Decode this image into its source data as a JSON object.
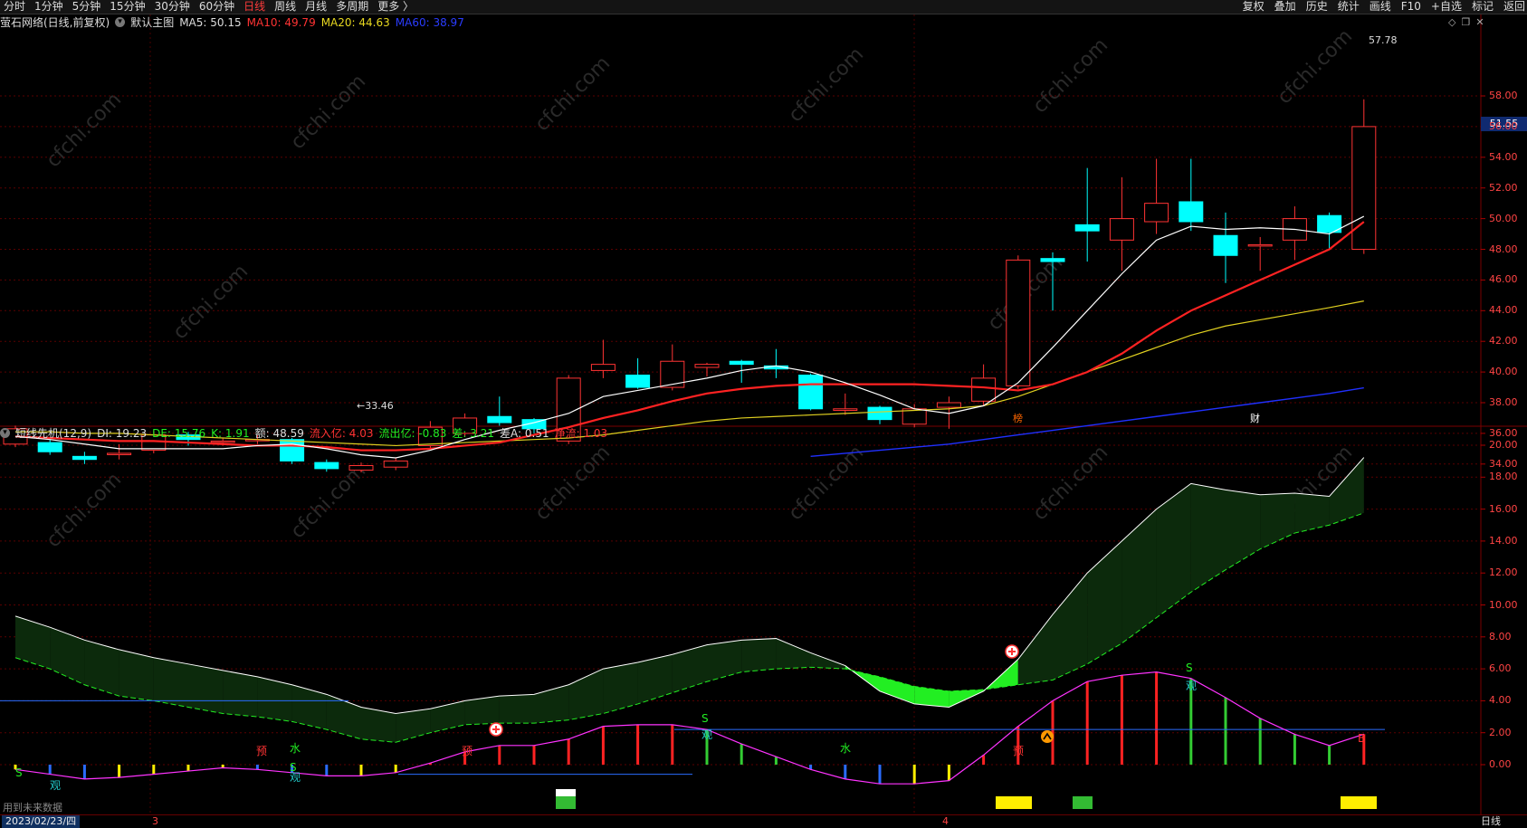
{
  "topbar": {
    "periods": [
      "分时",
      "1分钟",
      "5分钟",
      "15分钟",
      "30分钟",
      "60分钟",
      "日线",
      "周线",
      "月线",
      "多周期",
      "更多 〉"
    ],
    "active_period": "日线",
    "tools": [
      "复权",
      "叠加",
      "历史",
      "统计",
      "画线",
      "F10",
      "+自选",
      "标记",
      "返回"
    ]
  },
  "main": {
    "title": "萤石网络(日线,前复权)",
    "template": "默认主图",
    "ma5_label": "MA5:",
    "ma5_value": "50.15",
    "ma10_label": "MA10:",
    "ma10_value": "49.79",
    "ma20_label": "MA20:",
    "ma20_value": "44.63",
    "ma60_label": "MA60:",
    "ma60_value": "38.97",
    "high_label": "57.78",
    "low_label": "←33.46",
    "current_price": "51.55",
    "y_axis": [
      "58.00",
      "56.00",
      "54.00",
      "52.00",
      "50.00",
      "48.00",
      "46.00",
      "44.00",
      "42.00",
      "40.00",
      "38.00",
      "36.00",
      "34.00"
    ],
    "event_markers": [
      "榜",
      "财"
    ]
  },
  "sub": {
    "title": "短线先机(12,9)",
    "di_label": "DI:",
    "di_value": "19.23",
    "de_label": "DE:",
    "de_value": "15.76",
    "k_label": "K:",
    "k_value": "1.91",
    "e_label": "额:",
    "e_value": "48.59",
    "in_label": "流入亿:",
    "in_value": "4.03",
    "out_label": "流出亿:",
    "out_value": "-0.83",
    "diff_label": "差:",
    "diff_value": "3.21",
    "diffa_label": "差A:",
    "diffa_value": "0.51",
    "net_label": "净流:",
    "net_value": "1.03",
    "y_axis": [
      "20.00",
      "18.00",
      "16.00",
      "14.00",
      "12.00",
      "10.00",
      "8.00",
      "6.00",
      "4.00",
      "2.00",
      "0.00"
    ],
    "signal_labels": [
      "S",
      "观",
      "预",
      "水",
      "S",
      "观",
      "预",
      "S",
      "观",
      "水",
      "预",
      "S",
      "观",
      "B"
    ]
  },
  "footer": {
    "note": "用到未来数据",
    "date": "2023/02/23/四",
    "month3": "3",
    "month4": "4",
    "period": "日线"
  },
  "watermark": "cfchi.com",
  "colors": {
    "up": "#ff3333",
    "down": "#00ffff",
    "ma5": "#ffffff",
    "ma10": "#ff2222",
    "ma20": "#e0d020",
    "ma60": "#2030ff",
    "band_bright": "#22ee22",
    "band_dark": "#0c2a0c",
    "grid": "#5a0000"
  },
  "chart_data": {
    "type": "candlestick",
    "candles": [
      {
        "o": 35.3,
        "c": 36.3,
        "h": 36.5,
        "l": 35.1
      },
      {
        "o": 35.4,
        "c": 34.8,
        "h": 35.6,
        "l": 34.6
      },
      {
        "o": 34.5,
        "c": 34.3,
        "h": 34.8,
        "l": 34.0
      },
      {
        "o": 34.7,
        "c": 34.7,
        "h": 35.3,
        "l": 34.3
      },
      {
        "o": 34.9,
        "c": 35.9,
        "h": 36.2,
        "l": 34.7
      },
      {
        "o": 35.9,
        "c": 35.6,
        "h": 36.1,
        "l": 35.2
      },
      {
        "o": 35.5,
        "c": 35.5,
        "h": 35.7,
        "l": 35.2
      },
      {
        "o": 35.6,
        "c": 35.6,
        "h": 35.9,
        "l": 35.3
      },
      {
        "o": 35.6,
        "c": 34.2,
        "h": 35.7,
        "l": 34.0
      },
      {
        "o": 34.1,
        "c": 33.7,
        "h": 34.3,
        "l": 33.5
      },
      {
        "o": 33.6,
        "c": 33.9,
        "h": 34.1,
        "l": 33.46
      },
      {
        "o": 33.8,
        "c": 34.2,
        "h": 34.4,
        "l": 33.6
      },
      {
        "o": 35.2,
        "c": 36.4,
        "h": 36.8,
        "l": 35.0
      },
      {
        "o": 36.0,
        "c": 37.0,
        "h": 37.3,
        "l": 35.8
      },
      {
        "o": 37.1,
        "c": 36.7,
        "h": 38.4,
        "l": 36.5
      },
      {
        "o": 36.9,
        "c": 36.3,
        "h": 37.0,
        "l": 36.0
      },
      {
        "o": 35.5,
        "c": 39.6,
        "h": 39.8,
        "l": 35.3
      },
      {
        "o": 40.1,
        "c": 40.5,
        "h": 42.1,
        "l": 39.6
      },
      {
        "o": 39.8,
        "c": 39.0,
        "h": 40.9,
        "l": 38.9
      },
      {
        "o": 39.0,
        "c": 40.7,
        "h": 41.8,
        "l": 38.8
      },
      {
        "o": 40.3,
        "c": 40.5,
        "h": 40.6,
        "l": 39.7
      },
      {
        "o": 40.7,
        "c": 40.5,
        "h": 40.8,
        "l": 39.3
      },
      {
        "o": 40.4,
        "c": 40.2,
        "h": 41.5,
        "l": 39.6
      },
      {
        "o": 39.8,
        "c": 37.6,
        "h": 39.9,
        "l": 37.5
      },
      {
        "o": 37.5,
        "c": 37.6,
        "h": 38.6,
        "l": 37.2
      },
      {
        "o": 37.7,
        "c": 36.9,
        "h": 37.8,
        "l": 36.6
      },
      {
        "o": 36.6,
        "c": 37.6,
        "h": 37.9,
        "l": 36.4
      },
      {
        "o": 37.7,
        "c": 38.0,
        "h": 38.4,
        "l": 36.3
      },
      {
        "o": 38.1,
        "c": 39.6,
        "h": 40.5,
        "l": 37.8
      },
      {
        "o": 39.1,
        "c": 47.3,
        "h": 47.6,
        "l": 38.9
      },
      {
        "o": 47.4,
        "c": 47.2,
        "h": 47.8,
        "l": 44.0
      },
      {
        "o": 49.6,
        "c": 49.2,
        "h": 53.3,
        "l": 47.2
      },
      {
        "o": 48.6,
        "c": 50.0,
        "h": 52.7,
        "l": 46.6
      },
      {
        "o": 49.8,
        "c": 51.0,
        "h": 53.9,
        "l": 49.0
      },
      {
        "o": 51.1,
        "c": 49.8,
        "h": 53.9,
        "l": 49.2
      },
      {
        "o": 48.9,
        "c": 47.6,
        "h": 50.4,
        "l": 45.8
      },
      {
        "o": 48.3,
        "c": 48.3,
        "h": 48.8,
        "l": 46.6
      },
      {
        "o": 48.6,
        "c": 50.0,
        "h": 50.8,
        "l": 47.3
      },
      {
        "o": 50.2,
        "c": 49.1,
        "h": 50.4,
        "l": 48.0
      },
      {
        "o": 48.0,
        "c": 56.0,
        "h": 57.78,
        "l": 47.7
      }
    ],
    "ma5": [
      35.8,
      35.6,
      35.3,
      35.0,
      35.0,
      35.0,
      35.0,
      35.2,
      35.3,
      35.0,
      34.6,
      34.4,
      34.9,
      35.6,
      36.2,
      36.7,
      37.3,
      38.4,
      38.8,
      39.2,
      39.6,
      40.1,
      40.4,
      40.0,
      39.3,
      38.5,
      37.6,
      37.3,
      37.8,
      39.3,
      41.6,
      44.0,
      46.4,
      48.6,
      49.5,
      49.3,
      49.4,
      49.3,
      49.0,
      50.15
    ],
    "ma10": [
      35.8,
      35.7,
      35.6,
      35.5,
      35.5,
      35.4,
      35.3,
      35.2,
      35.2,
      35.1,
      34.9,
      34.9,
      35.0,
      35.2,
      35.4,
      35.9,
      36.4,
      37.0,
      37.5,
      38.1,
      38.6,
      38.9,
      39.1,
      39.2,
      39.2,
      39.2,
      39.2,
      39.1,
      39.0,
      38.8,
      39.2,
      40.0,
      41.2,
      42.7,
      44.0,
      45.0,
      46.0,
      47.0,
      48.0,
      49.79
    ],
    "ma20": [
      36.1,
      36.1,
      36.0,
      36.0,
      35.9,
      35.8,
      35.7,
      35.6,
      35.5,
      35.4,
      35.3,
      35.2,
      35.3,
      35.4,
      35.5,
      35.6,
      35.7,
      35.9,
      36.2,
      36.5,
      36.8,
      37.0,
      37.1,
      37.2,
      37.3,
      37.4,
      37.5,
      37.6,
      37.8,
      38.4,
      39.2,
      40.0,
      40.8,
      41.6,
      42.4,
      43.0,
      43.4,
      43.8,
      44.2,
      44.63
    ],
    "ma60_start_index": 24,
    "ma60": [
      34.5,
      34.7,
      34.9,
      35.1,
      35.3,
      35.6,
      35.9,
      36.2,
      36.5,
      36.8,
      37.1,
      37.4,
      37.7,
      38.0,
      38.3,
      38.6,
      38.97
    ],
    "di": [
      9.3,
      8.6,
      7.8,
      7.2,
      6.7,
      6.3,
      5.9,
      5.5,
      5.0,
      4.4,
      3.6,
      3.2,
      3.5,
      4.0,
      4.3,
      4.4,
      5.0,
      6.0,
      6.4,
      6.9,
      7.5,
      7.8,
      7.9,
      7.0,
      6.2,
      4.6,
      3.8,
      3.6,
      4.6,
      6.6,
      9.4,
      12.0,
      14.0,
      16.0,
      17.6,
      17.2,
      16.9,
      17.0,
      16.8,
      19.23
    ],
    "de": [
      6.7,
      6.0,
      5.0,
      4.3,
      4.0,
      3.6,
      3.2,
      3.0,
      2.7,
      2.2,
      1.6,
      1.4,
      2.0,
      2.5,
      2.6,
      2.6,
      2.8,
      3.2,
      3.8,
      4.5,
      5.2,
      5.8,
      6.0,
      6.1,
      6.0,
      5.5,
      4.9,
      4.6,
      4.7,
      5.0,
      5.3,
      6.3,
      7.6,
      9.2,
      10.8,
      12.2,
      13.5,
      14.5,
      15.0,
      15.76
    ],
    "k": [
      -0.3,
      -0.6,
      -0.9,
      -0.8,
      -0.6,
      -0.4,
      -0.2,
      -0.3,
      -0.5,
      -0.7,
      -0.7,
      -0.5,
      0.1,
      0.8,
      1.2,
      1.2,
      1.6,
      2.4,
      2.5,
      2.5,
      2.2,
      1.3,
      0.5,
      -0.3,
      -0.9,
      -1.2,
      -1.2,
      -1.0,
      0.6,
      2.4,
      4.0,
      5.2,
      5.6,
      5.8,
      5.4,
      4.2,
      2.9,
      1.9,
      1.2,
      1.91
    ],
    "k_ref_right": 2.2,
    "k_ref_left": 4.0
  }
}
